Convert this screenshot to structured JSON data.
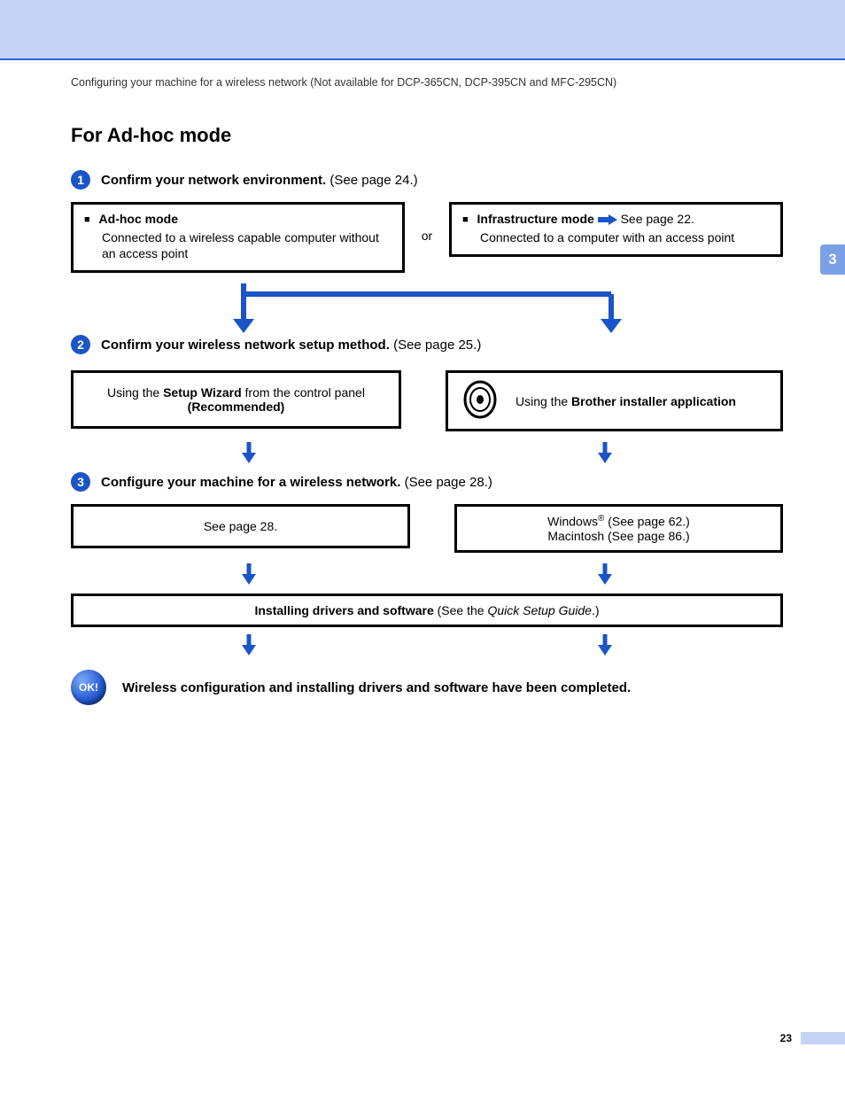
{
  "header": {
    "running_head": "Configuring your machine for a wireless network (Not available for DCP-365CN, DCP-395CN and MFC-295CN)"
  },
  "side_tab": "3",
  "section_title": "For Ad-hoc mode",
  "steps": {
    "s1": {
      "num": "1",
      "bold": "Confirm your network environment.",
      "rest": " (See page 24.)"
    },
    "s2": {
      "num": "2",
      "bold": "Confirm your wireless network setup method.",
      "rest": " (See page 25.)"
    },
    "s3": {
      "num": "3",
      "bold": "Configure your machine for a wireless network.",
      "rest": " (See page 28.)"
    }
  },
  "row1": {
    "left": {
      "title": "Ad-hoc mode",
      "body": "Connected to a wireless capable computer without an access point"
    },
    "or": "or",
    "right": {
      "title": "Infrastructure mode",
      "link": " See page 22.",
      "body": "Connected to a computer with an access point"
    }
  },
  "row2": {
    "left": {
      "pre": "Using the ",
      "bold": "Setup Wizard",
      "post": " from the control panel ",
      "rec": "(Recommended)"
    },
    "right": {
      "pre": "Using the ",
      "bold": "Brother installer application"
    }
  },
  "row3": {
    "left": "See page 28.",
    "right": {
      "win_pre": "Windows",
      "win_post": " (See page 62.)",
      "mac": "Macintosh (See page 86.)"
    }
  },
  "install_box": {
    "bold": "Installing drivers and software",
    "rest_pre": " (See the ",
    "italic": "Quick Setup Guide",
    "rest_post": ".)"
  },
  "ok_label": "OK!",
  "completion": "Wireless configuration and installing drivers and software have been completed.",
  "page_number": "23"
}
